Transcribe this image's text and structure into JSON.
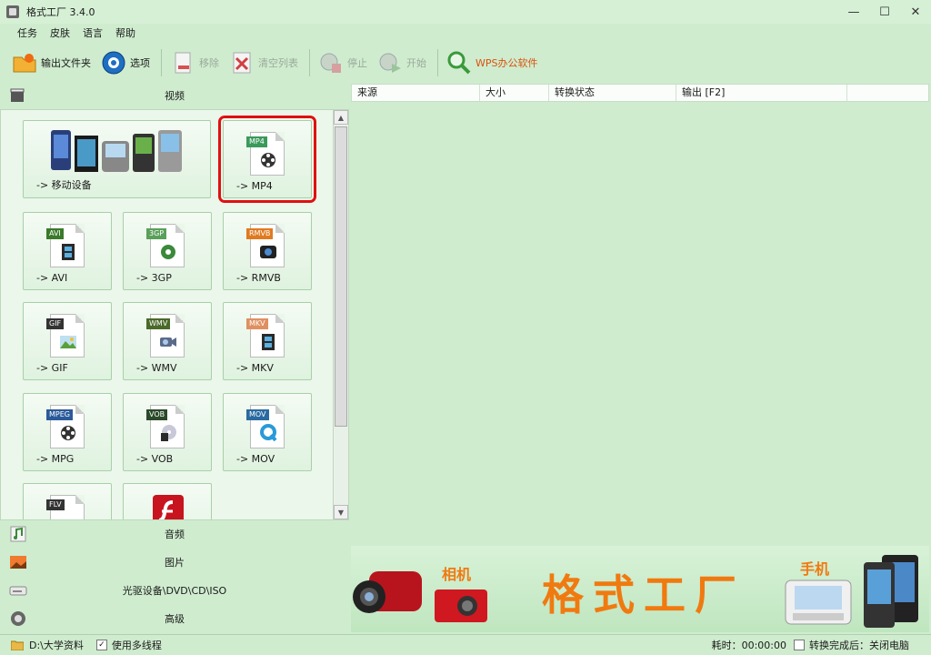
{
  "window": {
    "title": "格式工厂 3.4.0",
    "minimize": "—",
    "maximize": "☐",
    "close": "✕"
  },
  "menu": [
    "任务",
    "皮肤",
    "语言",
    "帮助"
  ],
  "toolbar": {
    "output_folder": "输出文件夹",
    "options": "选项",
    "remove": "移除",
    "clear_list": "清空列表",
    "stop": "停止",
    "start": "开始",
    "wps": "WPS办公软件"
  },
  "categories": {
    "video": "视频",
    "audio": "音频",
    "image": "图片",
    "disc": "光驱设备\\DVD\\CD\\ISO",
    "advanced": "高级"
  },
  "video_tiles": {
    "mobile": "-> 移动设备",
    "mp4": {
      "label": "-> MP4",
      "badge": "MP4"
    },
    "avi": {
      "label": "-> AVI",
      "badge": "AVI"
    },
    "3gp": {
      "label": "-> 3GP",
      "badge": "3GP"
    },
    "rmvb": {
      "label": "-> RMVB",
      "badge": "RMVB"
    },
    "gif": {
      "label": "-> GIF",
      "badge": "GIF"
    },
    "wmv": {
      "label": "-> WMV",
      "badge": "WMV"
    },
    "mkv": {
      "label": "-> MKV",
      "badge": "MKV"
    },
    "mpg": {
      "label": "-> MPG",
      "badge": "MPEG"
    },
    "vob": {
      "label": "-> VOB",
      "badge": "VOB"
    },
    "mov": {
      "label": "-> MOV",
      "badge": "MOV"
    },
    "flv": {
      "badge": "FLV"
    }
  },
  "task_list": {
    "columns": [
      "来源",
      "大小",
      "转换状态",
      "输出 [F2]"
    ]
  },
  "banner": {
    "title": "格式工厂",
    "camera": "相机",
    "phone": "手机"
  },
  "status": {
    "output_path": "D:\\大学资料",
    "multithread": "使用多线程",
    "elapsed": "耗时：00:00:00",
    "after_done": "转换完成后：关闭电脑"
  },
  "colors": {
    "accent": "#f07a10",
    "highlight": "#e01010",
    "background": "#cfeccf"
  }
}
